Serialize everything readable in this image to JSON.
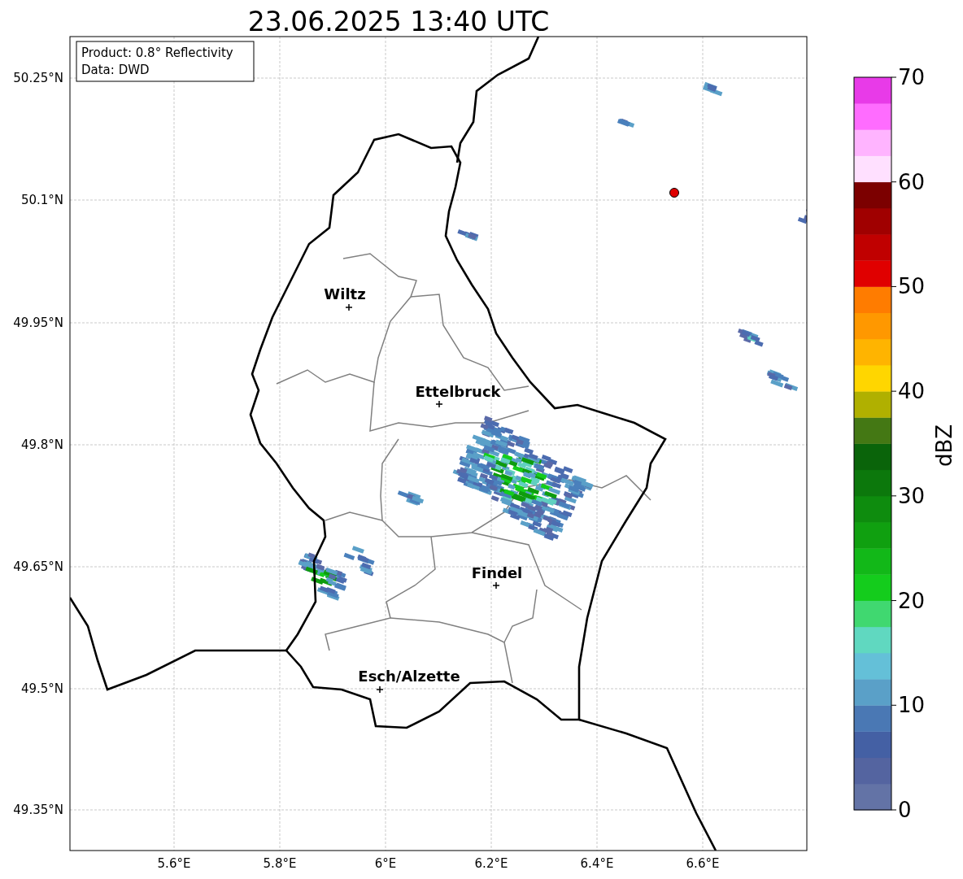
{
  "title": "23.06.2025 13:40 UTC",
  "map": {
    "info_box": [
      "Product: 0.8° Reflectivity",
      "Data: DWD"
    ],
    "lat_labels": [
      "50.25°N",
      "50.1°N",
      "49.95°N",
      "49.8°N",
      "49.65°N",
      "49.5°N",
      "49.35°N"
    ],
    "lon_labels": [
      "5.6°E",
      "5.8°E",
      "6°E",
      "6.2°E",
      "6.4°E",
      "6.6°E"
    ],
    "places": [
      {
        "name": "Wiltz"
      },
      {
        "name": "Ettelbruck"
      },
      {
        "name": "Findel"
      },
      {
        "name": "Esch/Alzette"
      }
    ]
  },
  "colorbar": {
    "label": "dBZ",
    "ticks": [
      "70",
      "60",
      "50",
      "40",
      "30",
      "20",
      "10",
      "0"
    ],
    "bands": [
      {
        "color": "#6373a6"
      },
      {
        "color": "#5464a0"
      },
      {
        "color": "#4460a4"
      },
      {
        "color": "#4a78b4"
      },
      {
        "color": "#5aa0c8"
      },
      {
        "color": "#64c0d8"
      },
      {
        "color": "#60d8c0"
      },
      {
        "color": "#40d870"
      },
      {
        "color": "#14cc1c"
      },
      {
        "color": "#12b818"
      },
      {
        "color": "#10a010"
      },
      {
        "color": "#0e8c0e"
      },
      {
        "color": "#0c780c"
      },
      {
        "color": "#0a640a"
      },
      {
        "color": "#447814"
      },
      {
        "color": "#b0b000"
      },
      {
        "color": "#ffd600"
      },
      {
        "color": "#ffb400"
      },
      {
        "color": "#ff9800"
      },
      {
        "color": "#ff7c00"
      },
      {
        "color": "#e00000"
      },
      {
        "color": "#c00000"
      },
      {
        "color": "#a00000"
      },
      {
        "color": "#7c0000"
      },
      {
        "color": "#ffe0ff"
      },
      {
        "color": "#ffb4ff"
      },
      {
        "color": "#ff6cff"
      },
      {
        "color": "#e83ae8"
      }
    ]
  }
}
